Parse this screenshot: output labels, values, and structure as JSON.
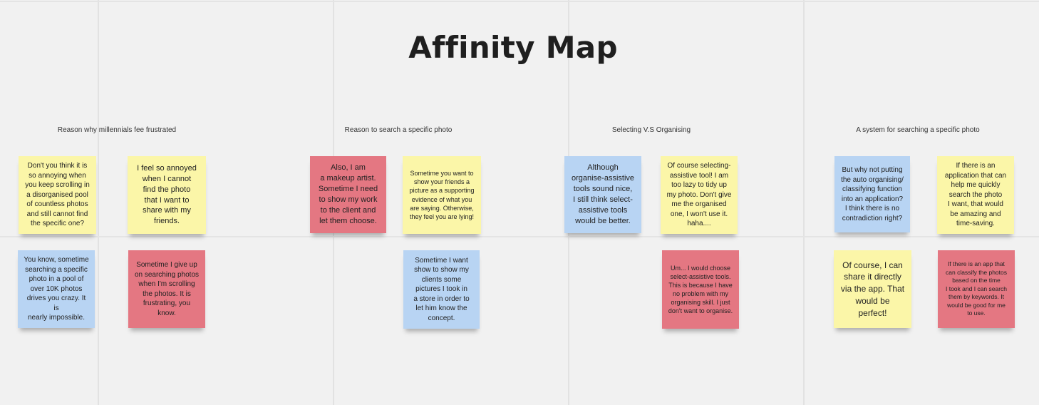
{
  "title": "Affinity Map",
  "categories": [
    "Reason why millennials fee frustrated",
    "Reason to search a specific photo",
    "Selecting V.S Organising",
    "A system for searching a specific photo"
  ],
  "colors": {
    "yellow": "#fbf6a8",
    "red": "#e47782",
    "blue": "#b8d4f3",
    "background": "#f1f1f1"
  },
  "notes": [
    {
      "color": "yellow",
      "text": "Don't you think it is\nso annoying when\nyou keep scrolling in\na disorganised pool\nof countless photos\nand still cannot find\nthe specific one?"
    },
    {
      "color": "yellow",
      "text": "I feel so annoyed\nwhen I cannot\nfind the photo\nthat I want to\nshare with my\nfriends."
    },
    {
      "color": "blue",
      "text": "You know, sometime\nsearching a specific\nphoto in a pool of\nover 10K photos\ndrives you crazy. It is\nnearly impossible."
    },
    {
      "color": "red",
      "text": "Sometime I give up\non searching photos\nwhen I'm scrolling\nthe photos. It is\nfrustrating, you\nknow."
    },
    {
      "color": "red",
      "text": "Also, I am\na makeup artist.\nSometime I need\nto show my work\nto the client and\nlet them choose."
    },
    {
      "color": "yellow",
      "text": "Sometime you want to\nshow your friends a\npicture as a supporting\nevidence of what you\nare saying. Otherwise,\nthey feel you are lying!"
    },
    {
      "color": "blue",
      "text": "Sometime I want\nshow to show my\nclients some\npictures I took in\na store in order to\nlet him know the\nconcept."
    },
    {
      "color": "blue",
      "text": "Although\norganise-assistive\ntools sound nice,\nI still think select-\nassistive tools\nwould be better."
    },
    {
      "color": "yellow",
      "text": "Of course selecting-\nassistive tool! I am\ntoo lazy to tidy up\nmy photo. Don't give\nme the organised\none, I won't use it.\nhaha...."
    },
    {
      "color": "red",
      "text": "Um... I would choose\nselect-assistive tools.\nThis is because I have\nno problem with my\norganising skill. I just\ndon't want to organise."
    },
    {
      "color": "blue",
      "text": "But why not putting\nthe auto organising/\nclassifying function\ninto an application?\nI think there is no\ncontradiction right?"
    },
    {
      "color": "yellow",
      "text": "If there is an\napplication that can\nhelp me quickly\nsearch the photo\nI want, that would\nbe amazing and\ntime-saving."
    },
    {
      "color": "yellow",
      "text": "Of course, I can\nshare it directly\nvia the app. That\nwould be\nperfect!"
    },
    {
      "color": "red",
      "text": "If there is an app that\ncan classify the photos\nbased on the time\nI took and I can search\nthem by keywords. It\nwould be good for me\nto use."
    }
  ]
}
